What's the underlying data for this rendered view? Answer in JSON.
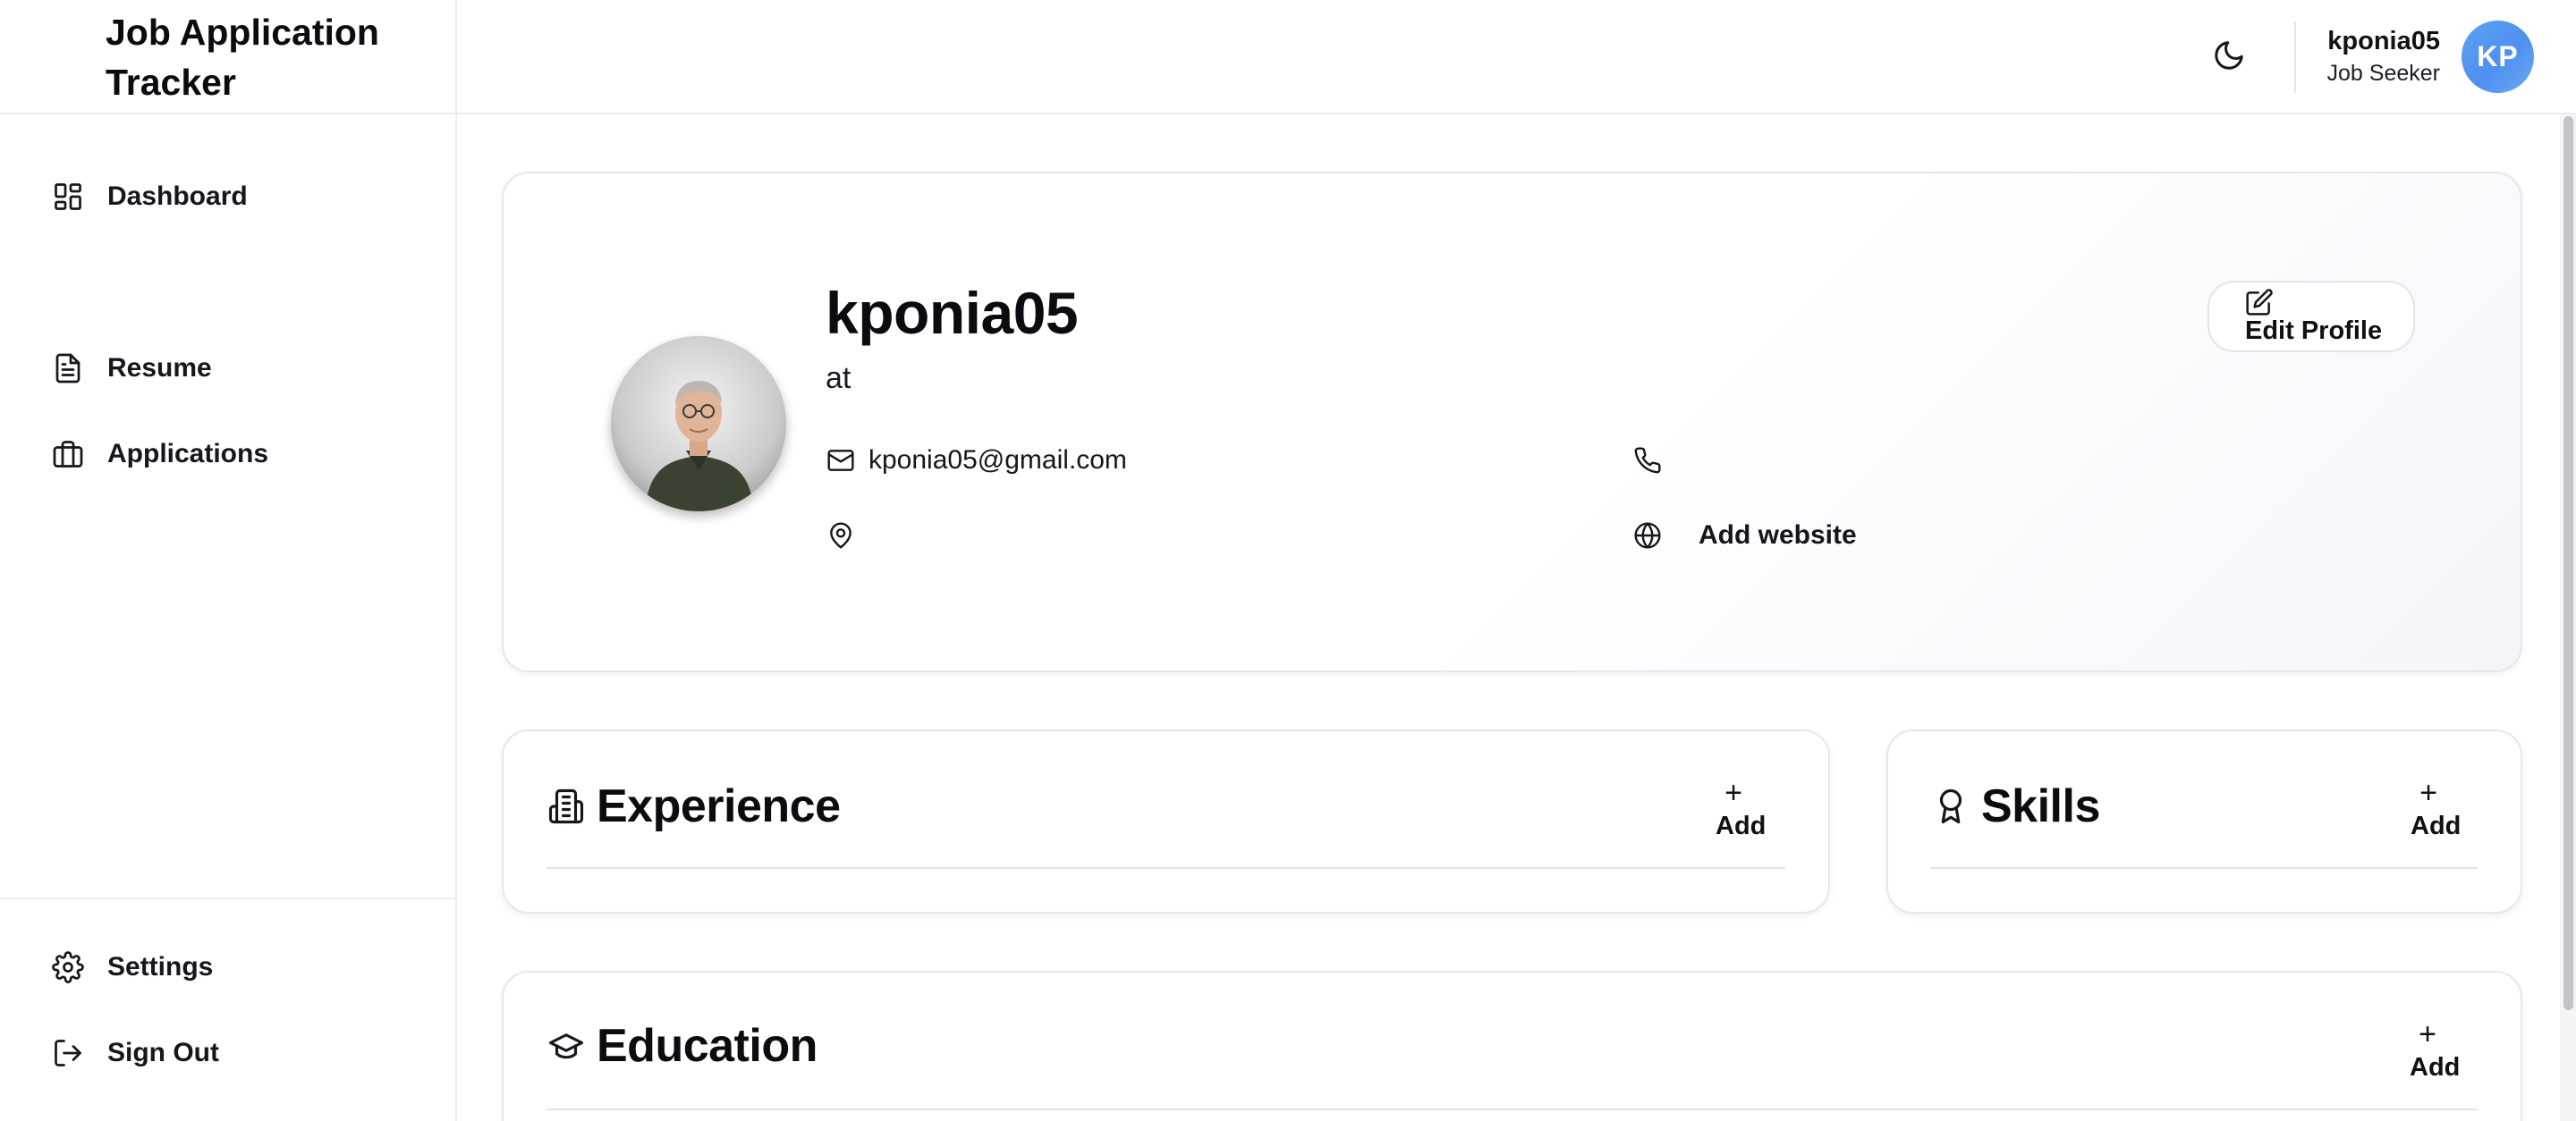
{
  "app": {
    "title": "Job Application Tracker"
  },
  "sidebar": {
    "items": [
      {
        "label": "Dashboard",
        "icon": "dashboard-icon"
      },
      {
        "label": "Resume",
        "icon": "file-icon"
      },
      {
        "label": "Applications",
        "icon": "briefcase-icon"
      }
    ],
    "bottom_items": [
      {
        "label": "Settings",
        "icon": "gear-icon"
      },
      {
        "label": "Sign Out",
        "icon": "sign-out-icon"
      }
    ]
  },
  "header": {
    "theme_icon": "moon-icon",
    "user": {
      "name": "kponia05",
      "role": "Job Seeker",
      "initials": "KP"
    }
  },
  "profile": {
    "name": "kponia05",
    "headline": "at",
    "email": "kponia05@gmail.com",
    "phone": "",
    "location": "",
    "website_label": "Add website",
    "edit_label": "Edit Profile"
  },
  "sections": {
    "experience": {
      "title": "Experience",
      "add_label": "Add",
      "icon": "building-icon"
    },
    "skills": {
      "title": "Skills",
      "add_label": "Add",
      "icon": "award-icon"
    },
    "education": {
      "title": "Education",
      "add_label": "Add",
      "icon": "graduation-cap-icon"
    }
  },
  "colors": {
    "avatar_gradient_start": "#5aa4f2",
    "avatar_gradient_end": "#4f8ff0",
    "border": "#e7e7eb",
    "text": "#0b0b10"
  }
}
